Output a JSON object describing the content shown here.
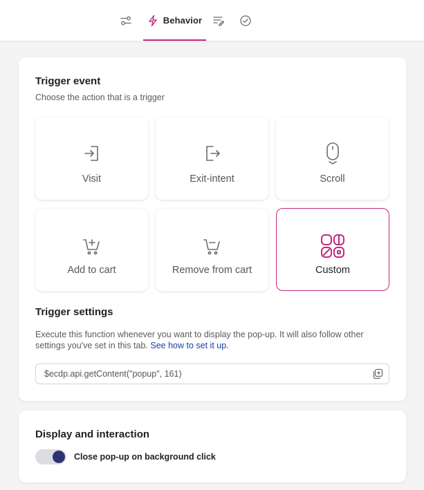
{
  "tabs": {
    "settings": {
      "icon": "sliders-icon"
    },
    "behavior": {
      "label": "Behavior",
      "icon": "lightning-icon"
    },
    "content": {
      "icon": "list-edit-icon"
    },
    "summary": {
      "icon": "check-circle-icon"
    }
  },
  "trigger_event": {
    "title": "Trigger event",
    "subtitle": "Choose the action that is a trigger",
    "options": [
      {
        "label": "Visit",
        "icon": "enter-icon"
      },
      {
        "label": "Exit-intent",
        "icon": "exit-icon"
      },
      {
        "label": "Scroll",
        "icon": "mouse-scroll-icon"
      },
      {
        "label": "Add to cart",
        "icon": "cart-add-icon"
      },
      {
        "label": "Remove from cart",
        "icon": "cart-remove-icon"
      },
      {
        "label": "Custom",
        "icon": "custom-grid-icon"
      }
    ],
    "selected": "Custom"
  },
  "trigger_settings": {
    "title": "Trigger settings",
    "description": "Execute this function whenever you want to display the pop-up. It will also follow other settings you've set in this tab. ",
    "link_text": "See how to set it up.",
    "code_value": "$ecdp.api.getContent(\"popup\", 161)"
  },
  "display": {
    "title": "Display and interaction",
    "toggle_label": "Close pop-up on background click",
    "toggle_on": true
  },
  "colors": {
    "accent": "#c2277f",
    "toggle_on": "#2c3274",
    "link": "#1a3ea8"
  }
}
